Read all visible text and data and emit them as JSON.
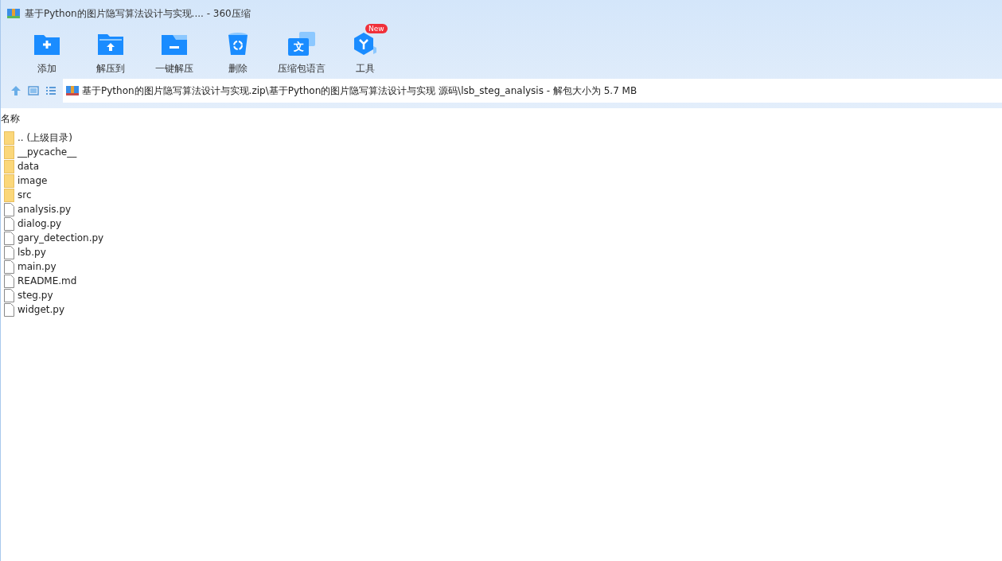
{
  "window": {
    "title": "基于Python的图片隐写算法设计与实现.... - 360压缩"
  },
  "toolbar": [
    {
      "kind": "add",
      "label": "添加"
    },
    {
      "kind": "extract",
      "label": "解压到"
    },
    {
      "kind": "oneclick",
      "label": "一键解压"
    },
    {
      "kind": "delete",
      "label": "删除"
    },
    {
      "kind": "language",
      "label": "压缩包语言",
      "glyph": "文"
    },
    {
      "kind": "tools",
      "label": "工具",
      "badge": "New"
    }
  ],
  "address": {
    "path": "基于Python的图片隐写算法设计与实现.zip\\基于Python的图片隐写算法设计与实现 源码\\lsb_steg_analysis - 解包大小为 5.7 MB"
  },
  "table": {
    "columns": [
      "名称"
    ],
    "rows": [
      {
        "kind": "folder",
        "name": ".. (上级目录)"
      },
      {
        "kind": "folder",
        "name": "__pycache__"
      },
      {
        "kind": "folder",
        "name": "data"
      },
      {
        "kind": "folder",
        "name": "image"
      },
      {
        "kind": "folder",
        "name": "src"
      },
      {
        "kind": "file",
        "name": "analysis.py"
      },
      {
        "kind": "file",
        "name": "dialog.py"
      },
      {
        "kind": "file",
        "name": "gary_detection.py"
      },
      {
        "kind": "file",
        "name": "lsb.py"
      },
      {
        "kind": "file",
        "name": "main.py"
      },
      {
        "kind": "file",
        "name": "README.md"
      },
      {
        "kind": "file",
        "name": "steg.py"
      },
      {
        "kind": "file",
        "name": "widget.py"
      }
    ]
  }
}
